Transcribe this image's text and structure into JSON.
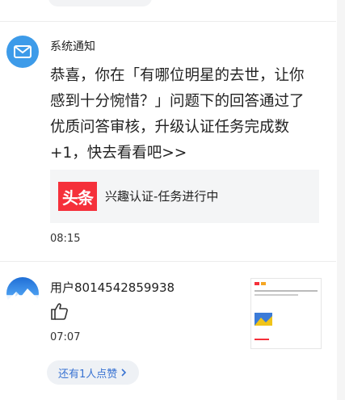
{
  "system_notice": {
    "sender": "系统通知",
    "message": "恭喜，你在「有哪位明星的去世，让你感到十分惋惜？」问题下的回答通过了优质问答审核，升级认证任务完成数+1，快去看看吧>>",
    "card": {
      "logo_text": "头条",
      "title": "兴趣认证-任务进行中"
    },
    "time": "08:15",
    "icon": "mail-icon",
    "accent_color": "#3d9be9"
  },
  "like_notice": {
    "user": "用户8014542859938",
    "icon": "thumbs-up-icon",
    "time": "07:07",
    "more_label": "还有1人点赞",
    "more_color": "#3973d2"
  }
}
